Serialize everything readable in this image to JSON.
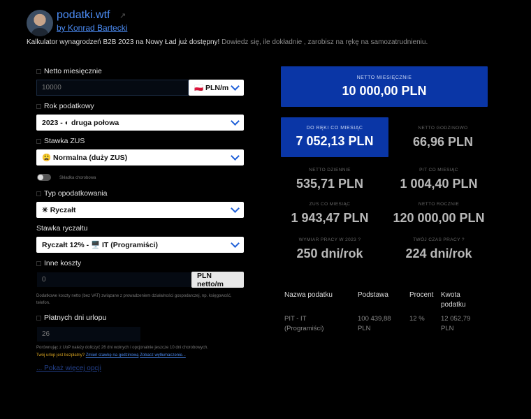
{
  "header": {
    "site_title": "podatki.wtf",
    "ext_icon": "↗",
    "byline": "by Konrad Bartecki"
  },
  "announcement": {
    "text": "Kalkulator wynagrodzeń B2B 2023 na Nowy Ład już dostępny!",
    "muted": " Dowiedz się, ile dokładnie     , zarobisz na rękę na samozatrudnieniu."
  },
  "form": {
    "netto_label": "Netto miesięcznie",
    "netto_value": "10000",
    "netto_unit": "🇵🇱 PLN/m",
    "year_label": "Rok podatkowy",
    "year_value": "2023 - ◐ druga połowa",
    "zus_label": "Stawka ZUS",
    "zus_value": "😩 Normalna (duży ZUS)",
    "sickness_label": "Składka chorobowa",
    "tax_type_label": "Typ opodatkowania",
    "tax_type_value": "✳ Ryczałt",
    "rate_label": "Stawka ryczałtu",
    "rate_value": "Ryczałt 12% - 🖥️ IT (Programiści)",
    "costs_label": "Inne koszty",
    "costs_value": "0",
    "costs_unit": "PLN netto/m",
    "costs_note": "Dodatkowe koszty netto (bez VAT) związane z prowadzeniem działalności gospodarczej, np. księgowość, telefon.",
    "vacation_label": "Płatnych dni urlopu",
    "vacation_value": "26",
    "vacation_note": "Porównując z UoP należy doliczyć 26 dni wolnych i opcjonalnie jeszcze 10 dni chorobowych.",
    "vac_free": "Twój urlop jest bezpłatny?",
    "vac_link1": "Zmień stawkę na godzinową",
    "vac_link2": "Zobacz wytłumaczenie...",
    "more": "... Pokaż więcej opcji"
  },
  "results": {
    "netto_monthly": {
      "label": "NETTO MIESIĘCZNIE",
      "value": "10 000,00 PLN"
    },
    "take_home": {
      "label": "DO RĘKI CO MIESIĄC",
      "value": "7 052,13 PLN"
    },
    "netto_hourly": {
      "label": "NETTO GODZINOWO",
      "value": "66,96 PLN"
    },
    "netto_daily": {
      "label": "NETTO DZIENNIE",
      "value": "535,71 PLN"
    },
    "pit_monthly": {
      "label": "PIT CO MIESIĄC",
      "value": "1 004,40 PLN"
    },
    "zus_monthly": {
      "label": "ZUS CO MIESIĄC",
      "value": "1 943,47 PLN"
    },
    "netto_yearly": {
      "label": "NETTO ROCZNIE",
      "value": "120 000,00 PLN"
    },
    "work_dim": {
      "label": "WYMIAR PRACY W 2023  ?",
      "value": "250 dni/rok"
    },
    "work_time": {
      "label": "TWÓJ CZAS PRACY  ?",
      "value": "224 dni/rok"
    }
  },
  "tax_table": {
    "headers": [
      "Nazwa podatku",
      "Podstawa",
      "Procent",
      "Kwota podatku"
    ],
    "row": {
      "name": "PIT -      IT (Programiści)",
      "base": "100 439,88 PLN",
      "percent": "12 %",
      "amount": "12 052,79 PLN"
    }
  },
  "colors": {
    "accent": "#0a36a6",
    "link": "#4b8cf5",
    "background": "#000000"
  }
}
